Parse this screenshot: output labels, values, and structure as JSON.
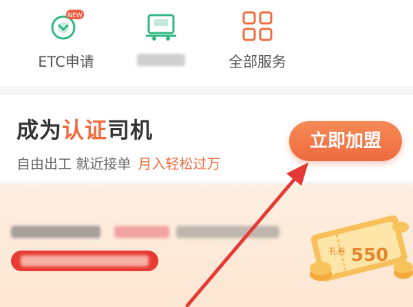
{
  "services": [
    {
      "label": "ETC申请",
      "icon": "etc-icon",
      "badge": "NEW"
    },
    {
      "label": "",
      "icon": "truck-icon"
    },
    {
      "label": "全部服务",
      "icon": "grid-icon"
    }
  ],
  "banner": {
    "title_pre": "成为",
    "title_hl": "认证",
    "title_post": "司机",
    "subtitle": "自由出工 就近接单",
    "subtitle_hl": "月入轻松过万",
    "button": "立即加盟"
  },
  "promo": {
    "coupon_value": "550",
    "coupon_label": "礼券"
  },
  "colors": {
    "accent": "#f06a3b",
    "green": "#2fb57f",
    "red": "#e73a32"
  }
}
